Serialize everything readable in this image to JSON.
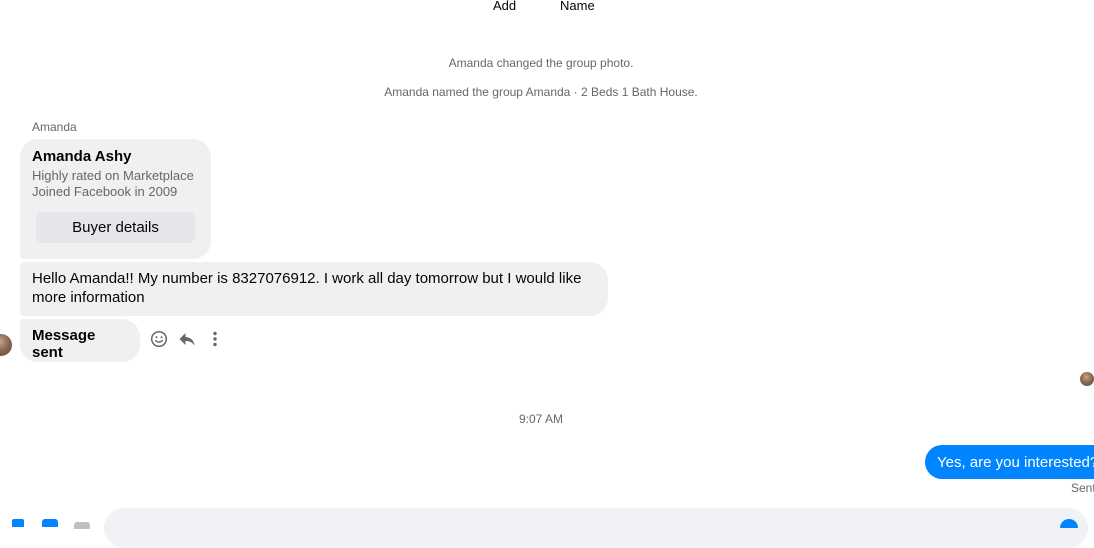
{
  "header": {
    "add_label": "Add",
    "name_label": "Name"
  },
  "system_messages": [
    "Amanda changed the group photo.",
    "Amanda named the group Amanda · 2 Beds 1 Bath House."
  ],
  "thread": {
    "sender_name": "Amanda",
    "profile_card": {
      "name": "Amanda Ashy",
      "line1": "Highly rated on Marketplace",
      "line2": "Joined Facebook in 2009",
      "button_label": "Buyer details"
    },
    "messages": [
      {
        "text": "Hello Amanda!! My number is 8327076912. I work all day tomorrow but I would like more information"
      },
      {
        "text": "Message sent"
      }
    ],
    "timestamp": "9:07 AM",
    "sent_message": "Yes, are you interested?",
    "sent_status": "Sent"
  },
  "icons": {
    "react": "smiley-icon",
    "reply": "reply-icon",
    "more": "more-vertical-icon"
  },
  "colors": {
    "accent": "#0084ff",
    "bubble_gray": "#f0f0f0",
    "secondary_text": "#65676b"
  }
}
